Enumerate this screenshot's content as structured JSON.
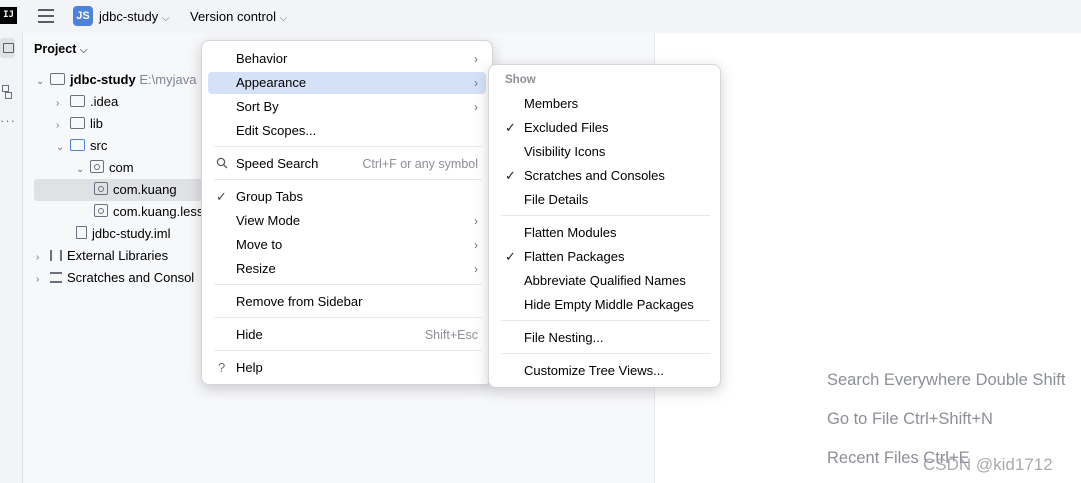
{
  "topbar": {
    "logo": "IJ",
    "project_initials": "JS",
    "project_name": "jdbc-study",
    "vcs_label": "Version control"
  },
  "panel": {
    "title": "Project",
    "tree": [
      {
        "label": "jdbc-study",
        "suffix": "E:\\myjava",
        "bold": true,
        "arrow": "expanded",
        "icon": "module-folder-icon"
      },
      {
        "label": ".idea",
        "arrow": "collapsed",
        "icon": "folder-icon"
      },
      {
        "label": "lib",
        "arrow": "collapsed",
        "icon": "folder-icon"
      },
      {
        "label": "src",
        "arrow": "expanded",
        "icon": "source-folder-icon"
      },
      {
        "label": "com",
        "arrow": "expanded",
        "icon": "package-icon"
      },
      {
        "label": "com.kuang",
        "icon": "package-icon",
        "selected": true
      },
      {
        "label": "com.kuang.less",
        "icon": "package-icon"
      },
      {
        "label": "jdbc-study.iml",
        "icon": "file-icon"
      },
      {
        "label": "External Libraries",
        "arrow": "collapsed",
        "icon": "library-icon"
      },
      {
        "label": "Scratches and Consol",
        "arrow": "collapsed",
        "icon": "scratches-icon"
      }
    ]
  },
  "menu_main": {
    "items": [
      {
        "label": "Behavior",
        "submenu": true
      },
      {
        "label": "Appearance",
        "submenu": true,
        "highlighted": true
      },
      {
        "label": "Sort By",
        "submenu": true
      },
      {
        "label": "Edit Scopes..."
      },
      {
        "label": "Speed Search",
        "shortcut": "Ctrl+F or any symbol",
        "icon": "search-icon"
      },
      {
        "label": "Group Tabs",
        "checked": true
      },
      {
        "label": "View Mode",
        "submenu": true
      },
      {
        "label": "Move to",
        "submenu": true
      },
      {
        "label": "Resize",
        "submenu": true
      },
      {
        "label": "Remove from Sidebar"
      },
      {
        "label": "Hide",
        "shortcut": "Shift+Esc"
      },
      {
        "label": "Help",
        "icon": "help-icon"
      }
    ]
  },
  "menu_appearance": {
    "header": "Show",
    "items": [
      {
        "label": "Members",
        "checked": false
      },
      {
        "label": "Excluded Files",
        "checked": true
      },
      {
        "label": "Visibility Icons",
        "checked": false
      },
      {
        "label": "Scratches and Consoles",
        "checked": true
      },
      {
        "label": "File Details",
        "checked": false
      },
      {
        "label": "Flatten Modules",
        "checked": false
      },
      {
        "label": "Flatten Packages",
        "checked": true
      },
      {
        "label": "Abbreviate Qualified Names",
        "checked": false
      },
      {
        "label": "Hide Empty Middle Packages",
        "checked": false
      },
      {
        "label": "File Nesting...",
        "checked": false
      },
      {
        "label": "Customize Tree Views...",
        "checked": false
      }
    ]
  },
  "editor": {
    "hints": [
      "Search Everywhere Double Shift",
      "Go to File Ctrl+Shift+N",
      "Recent Files Ctrl+E"
    ],
    "watermark": "CSDN @kid1712"
  },
  "glyphs": {
    "chevron_down": "⌵",
    "arrow_right": "›",
    "arrow_collapsed": "›",
    "arrow_expanded": "⌄",
    "check": "✓",
    "help": "?"
  }
}
